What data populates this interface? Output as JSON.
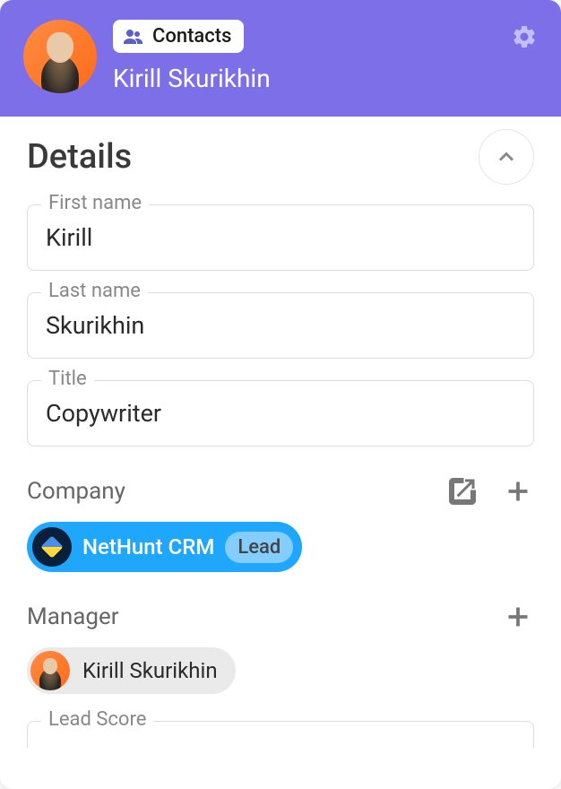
{
  "header": {
    "badge_label": "Contacts",
    "name": "Kirill Skurikhin"
  },
  "details": {
    "section_title": "Details",
    "fields": {
      "first_name": {
        "label": "First name",
        "value": "Kirill"
      },
      "last_name": {
        "label": "Last name",
        "value": "Skurikhin"
      },
      "title": {
        "label": "Title",
        "value": "Copywriter"
      }
    }
  },
  "company": {
    "section_title": "Company",
    "name": "NetHunt CRM",
    "status": "Lead"
  },
  "manager": {
    "section_title": "Manager",
    "name": "Kirill Skurikhin"
  },
  "lead_score": {
    "label": "Lead Score"
  }
}
